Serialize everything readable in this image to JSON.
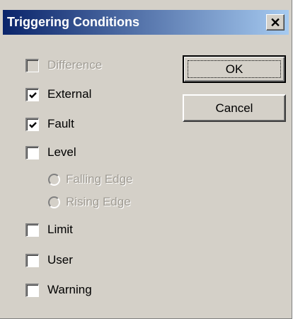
{
  "window": {
    "title": "Triggering Conditions",
    "close_glyph": "✕"
  },
  "buttons": {
    "ok_label": "OK",
    "cancel_label": "Cancel"
  },
  "options": [
    {
      "label": "Difference",
      "checked": false,
      "enabled": false
    },
    {
      "label": "External",
      "checked": true,
      "enabled": true
    },
    {
      "label": "Fault",
      "checked": true,
      "enabled": true
    },
    {
      "label": "Level",
      "checked": false,
      "enabled": true
    },
    {
      "label": "Limit",
      "checked": false,
      "enabled": true
    },
    {
      "label": "User",
      "checked": false,
      "enabled": true
    },
    {
      "label": "Warning",
      "checked": false,
      "enabled": true
    }
  ],
  "level_edges": [
    {
      "label": "Falling Edge",
      "selected": false,
      "enabled": false
    },
    {
      "label": "Rising Edge",
      "selected": false,
      "enabled": false
    }
  ],
  "colors": {
    "titlebar_start": "#0a246a",
    "titlebar_end": "#a6caf0",
    "face": "#d4d0c8"
  }
}
